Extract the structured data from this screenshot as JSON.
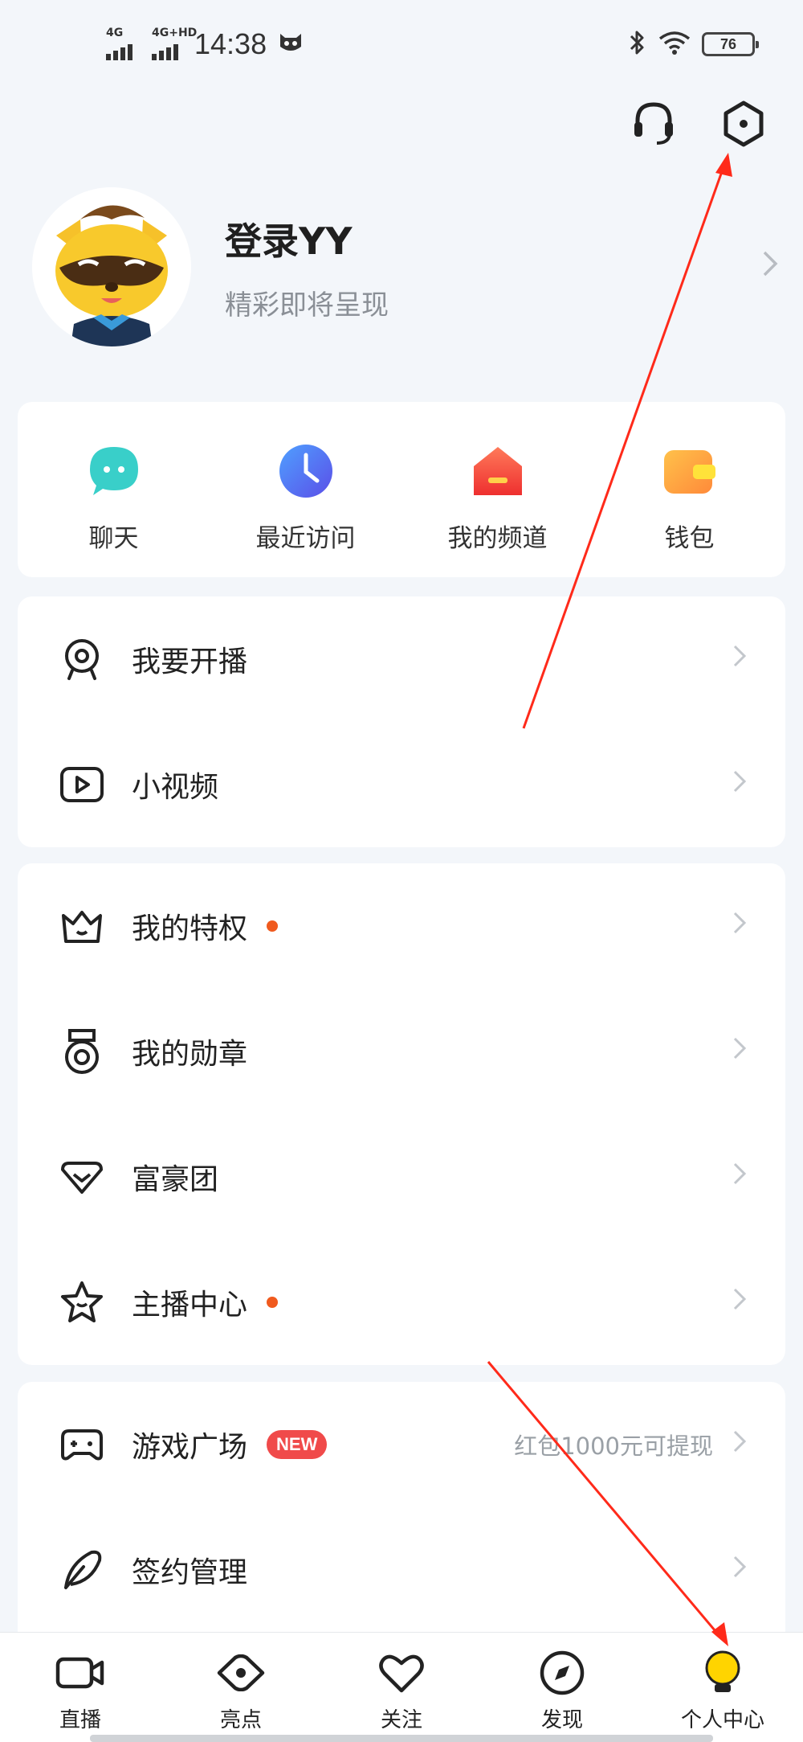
{
  "status_bar": {
    "signal_1": "4G",
    "signal_2": "4G+HD",
    "time": "14:38",
    "battery": "76"
  },
  "header": {
    "support_icon": "headset-icon",
    "settings_icon": "hexagon-settings-icon"
  },
  "profile": {
    "title": "登录YY",
    "subtitle": "精彩即将呈现"
  },
  "quick_actions": [
    {
      "label": "聊天",
      "icon": "chat-bubble-icon",
      "color": "#39cfc9"
    },
    {
      "label": "最近访问",
      "icon": "clock-icon",
      "color": "#4f6cf0"
    },
    {
      "label": "我的频道",
      "icon": "house-icon",
      "color": "#f0463c"
    },
    {
      "label": "钱包",
      "icon": "wallet-icon",
      "color": "#f6a531"
    }
  ],
  "section_1": [
    {
      "label": "我要开播",
      "icon": "webcam-icon"
    },
    {
      "label": "小视频",
      "icon": "play-video-icon"
    }
  ],
  "section_2": [
    {
      "label": "我的特权",
      "icon": "crown-icon",
      "dot": true
    },
    {
      "label": "我的勋章",
      "icon": "medal-icon",
      "dot": false
    },
    {
      "label": "富豪团",
      "icon": "diamond-icon",
      "dot": false
    },
    {
      "label": "主播中心",
      "icon": "star-icon",
      "dot": true
    }
  ],
  "section_3": [
    {
      "label": "游戏广场",
      "icon": "gamepad-icon",
      "badge": "NEW",
      "trail": "红包1000元可提现"
    },
    {
      "label": "签约管理",
      "icon": "feather-icon"
    }
  ],
  "tabbar": [
    {
      "label": "直播",
      "icon": "video-camera-icon"
    },
    {
      "label": "亮点",
      "icon": "eye-icon"
    },
    {
      "label": "关注",
      "icon": "heart-icon"
    },
    {
      "label": "发现",
      "icon": "compass-icon"
    },
    {
      "label": "个人中心",
      "icon": "lightbulb-icon",
      "active": true
    }
  ],
  "colors": {
    "accent_dot": "#f05a1e",
    "new_badge": "#f04a4a",
    "active_tab": "#ffd400",
    "annotation_arrow": "#ff2a1a"
  }
}
